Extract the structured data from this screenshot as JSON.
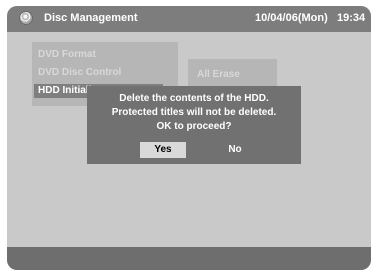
{
  "header": {
    "title": "Disc Management",
    "date": "10/04/06(Mon)",
    "time": "19:34",
    "icon": "disc-icon"
  },
  "menu": {
    "items": [
      {
        "label": "DVD Format"
      },
      {
        "label": "DVD Disc Control"
      },
      {
        "label": "HDD Initialize"
      }
    ],
    "right_panel": {
      "label": "All Erase"
    }
  },
  "dialog": {
    "line1": "Delete the contents of the HDD.",
    "line2": "Protected titles will not be deleted.",
    "line3": "OK to proceed?",
    "yes_label": "Yes",
    "no_label": "No"
  },
  "colors": {
    "screen_background": "#c9c9c9",
    "header_background": "#7d7d7d",
    "dialog_background": "#717171",
    "selected_button": "#d9d9d9"
  }
}
